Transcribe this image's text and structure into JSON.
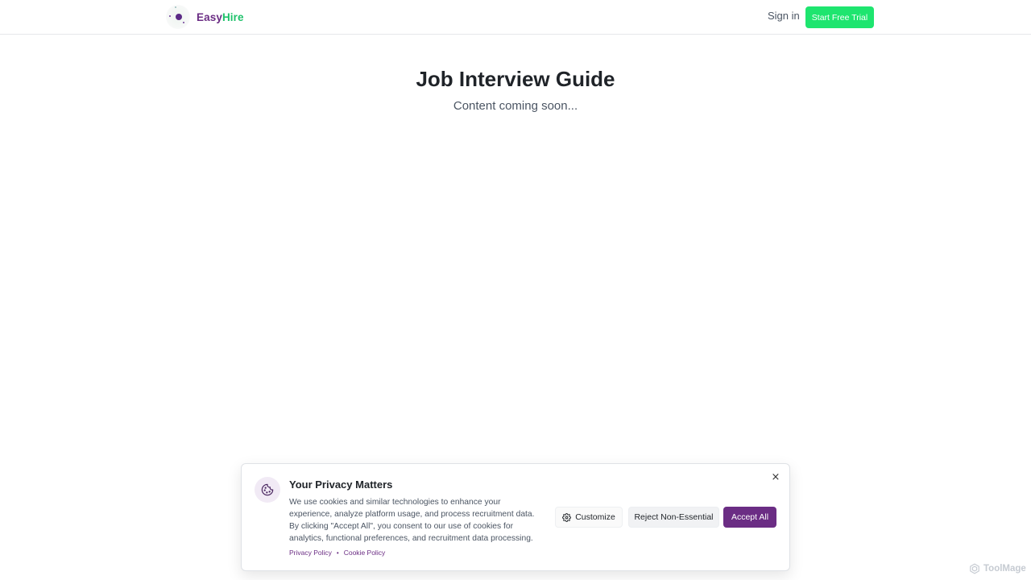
{
  "header": {
    "brand_part1": "Easy",
    "brand_part2": "Hire",
    "signin_label": "Sign in",
    "trial_label": "Start Free Trial"
  },
  "main": {
    "title": "Job Interview Guide",
    "subtitle": "Content coming soon..."
  },
  "cookie_banner": {
    "title": "Your Privacy Matters",
    "body": "We use cookies and similar technologies to enhance your experience, analyze platform usage, and process recruitment data. By clicking \"Accept All\", you consent to our use of cookies for analytics, functional preferences, and recruitment data processing.",
    "privacy_link": "Privacy Policy",
    "separator": "•",
    "cookie_link": "Cookie Policy",
    "close_label": "×",
    "customize_label": "Customize",
    "reject_label": "Reject Non-Essential",
    "accept_label": "Accept All"
  },
  "watermark": {
    "text": "ToolMage"
  },
  "colors": {
    "brand_purple": "#6b2d84",
    "brand_green": "#1fc26b",
    "trial_button": "#1ee56f"
  },
  "icons": {
    "logo": "easyhire-logo-icon",
    "cookie": "cookie-icon",
    "gear": "gear-icon",
    "close": "close-icon",
    "watermark": "toolmage-logo-icon"
  }
}
